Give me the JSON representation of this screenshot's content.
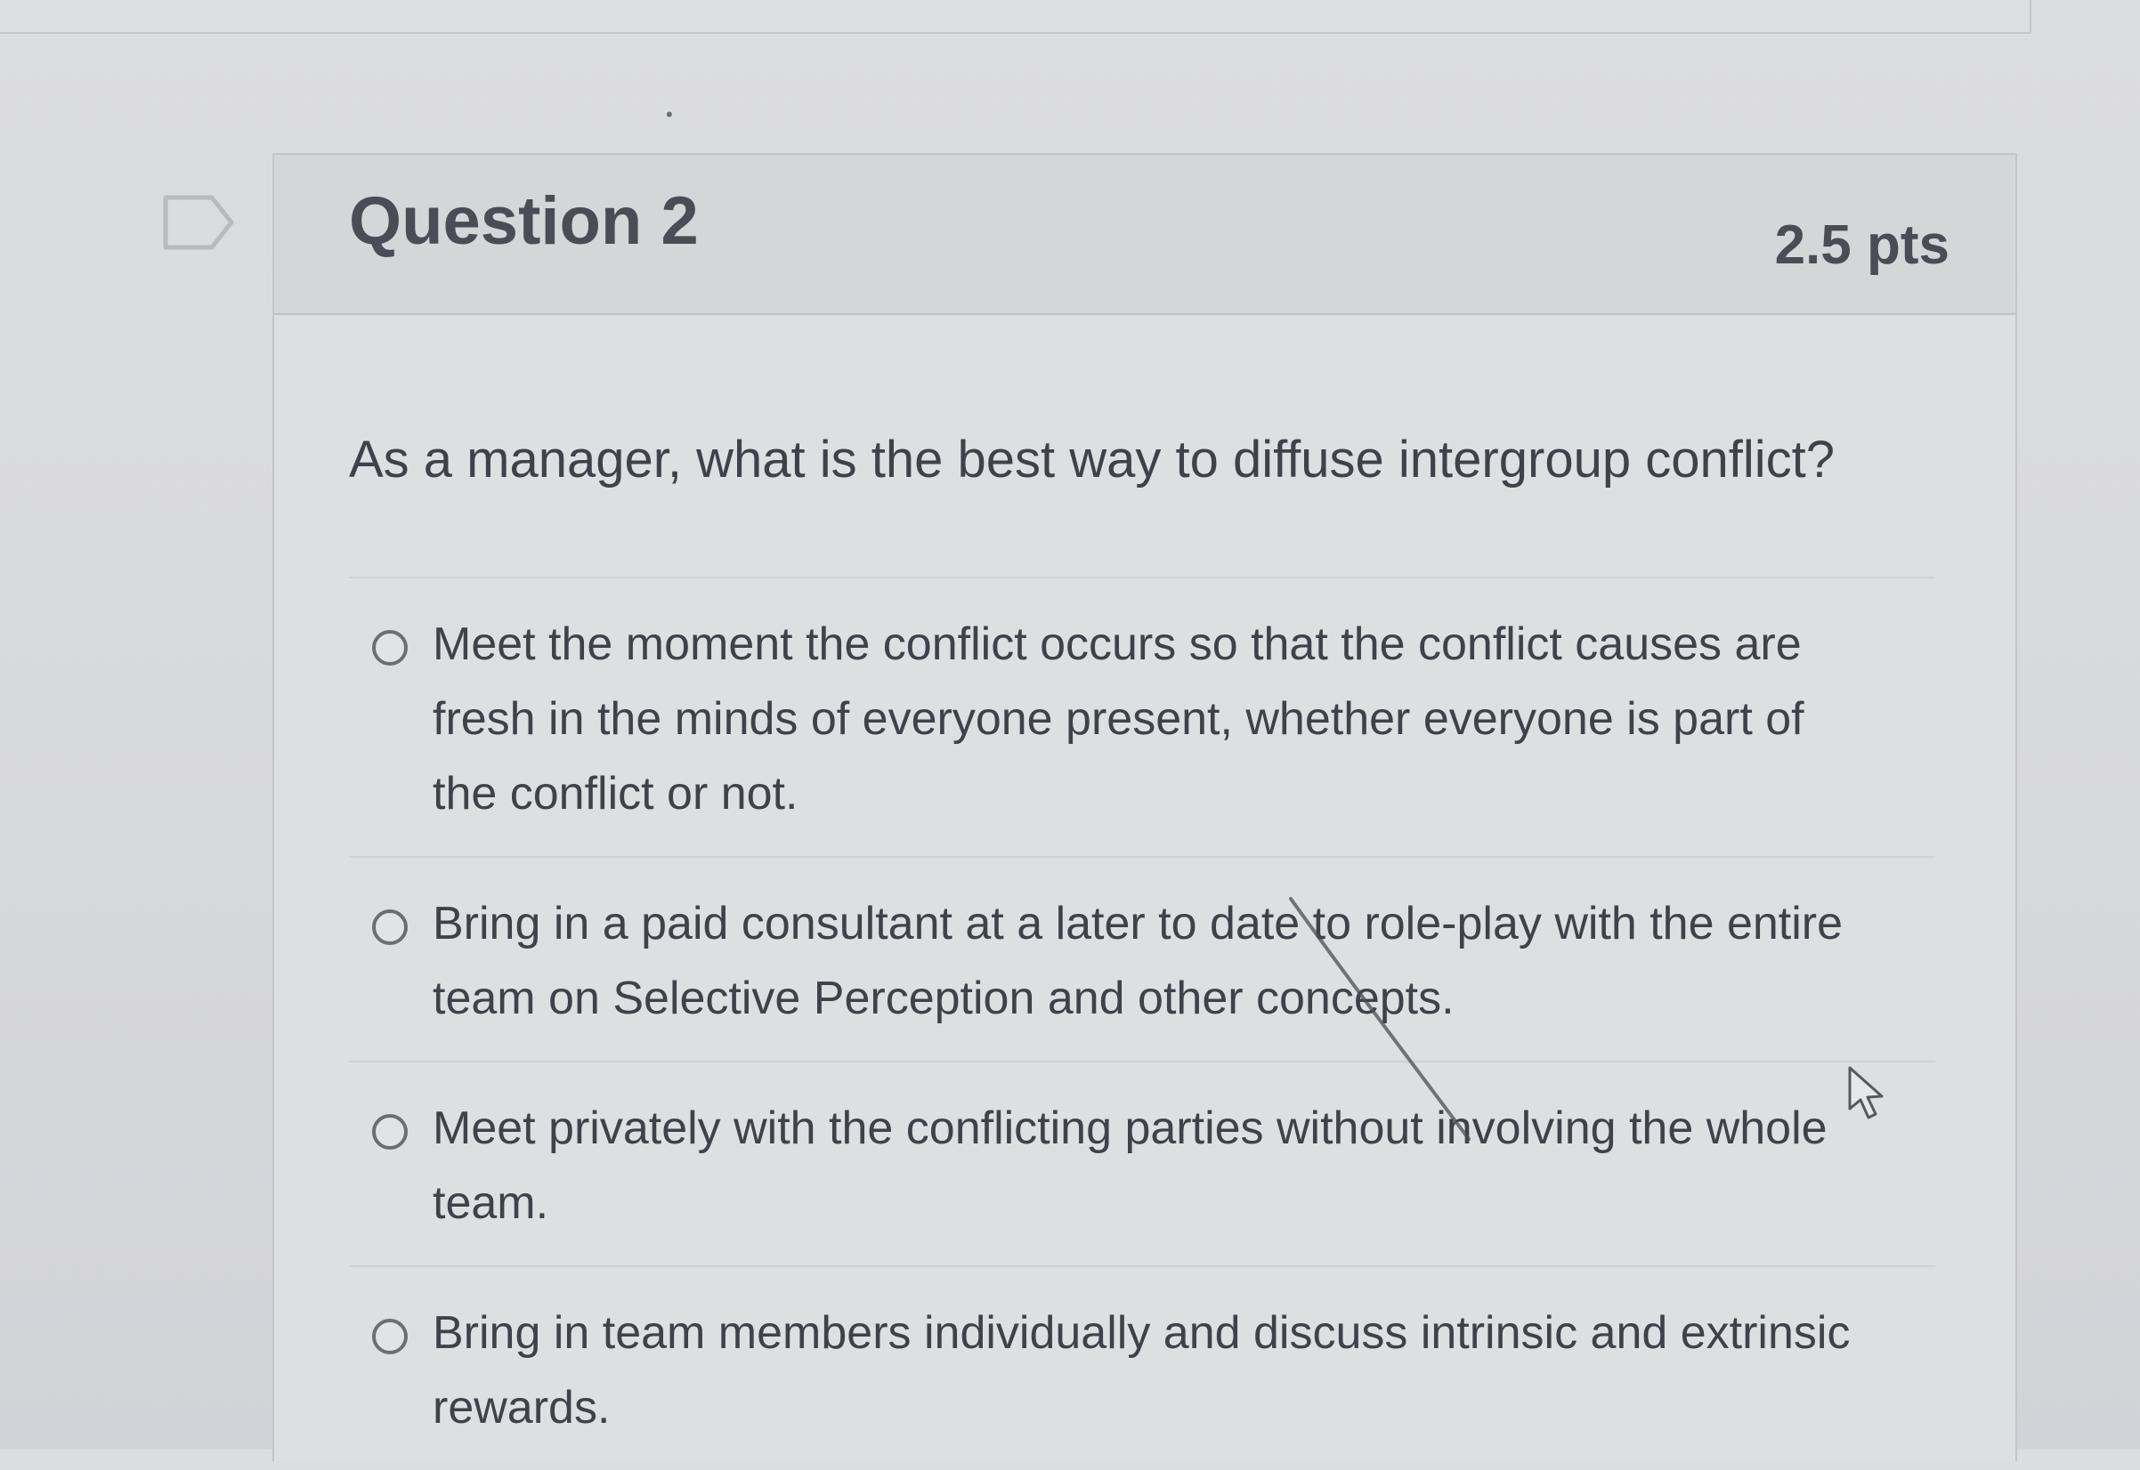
{
  "question": {
    "title": "Question 2",
    "points": "2.5 pts",
    "text": "As a manager, what is the best way to diffuse intergroup conflict?",
    "options": [
      {
        "label": "Meet the moment the conflict occurs so that the conflict causes are fresh in the minds of everyone present, whether everyone is part of the conflict or not."
      },
      {
        "label": "Bring in a paid consultant at a later to date to role-play with the entire team on Selective Perception and other concepts."
      },
      {
        "label": "Meet privately with the conflicting parties without involving the whole team."
      },
      {
        "label": "Bring in team members individually and discuss intrinsic and extrinsic rewards."
      }
    ]
  },
  "icons": {
    "flag": "bookmark-flag-icon",
    "radio": "radio-unselected-icon",
    "cursor": "mouse-pointer-icon"
  },
  "colors": {
    "text": "#3f424a",
    "header_bg": "#d5d6d9",
    "border": "#c3c5c9"
  }
}
